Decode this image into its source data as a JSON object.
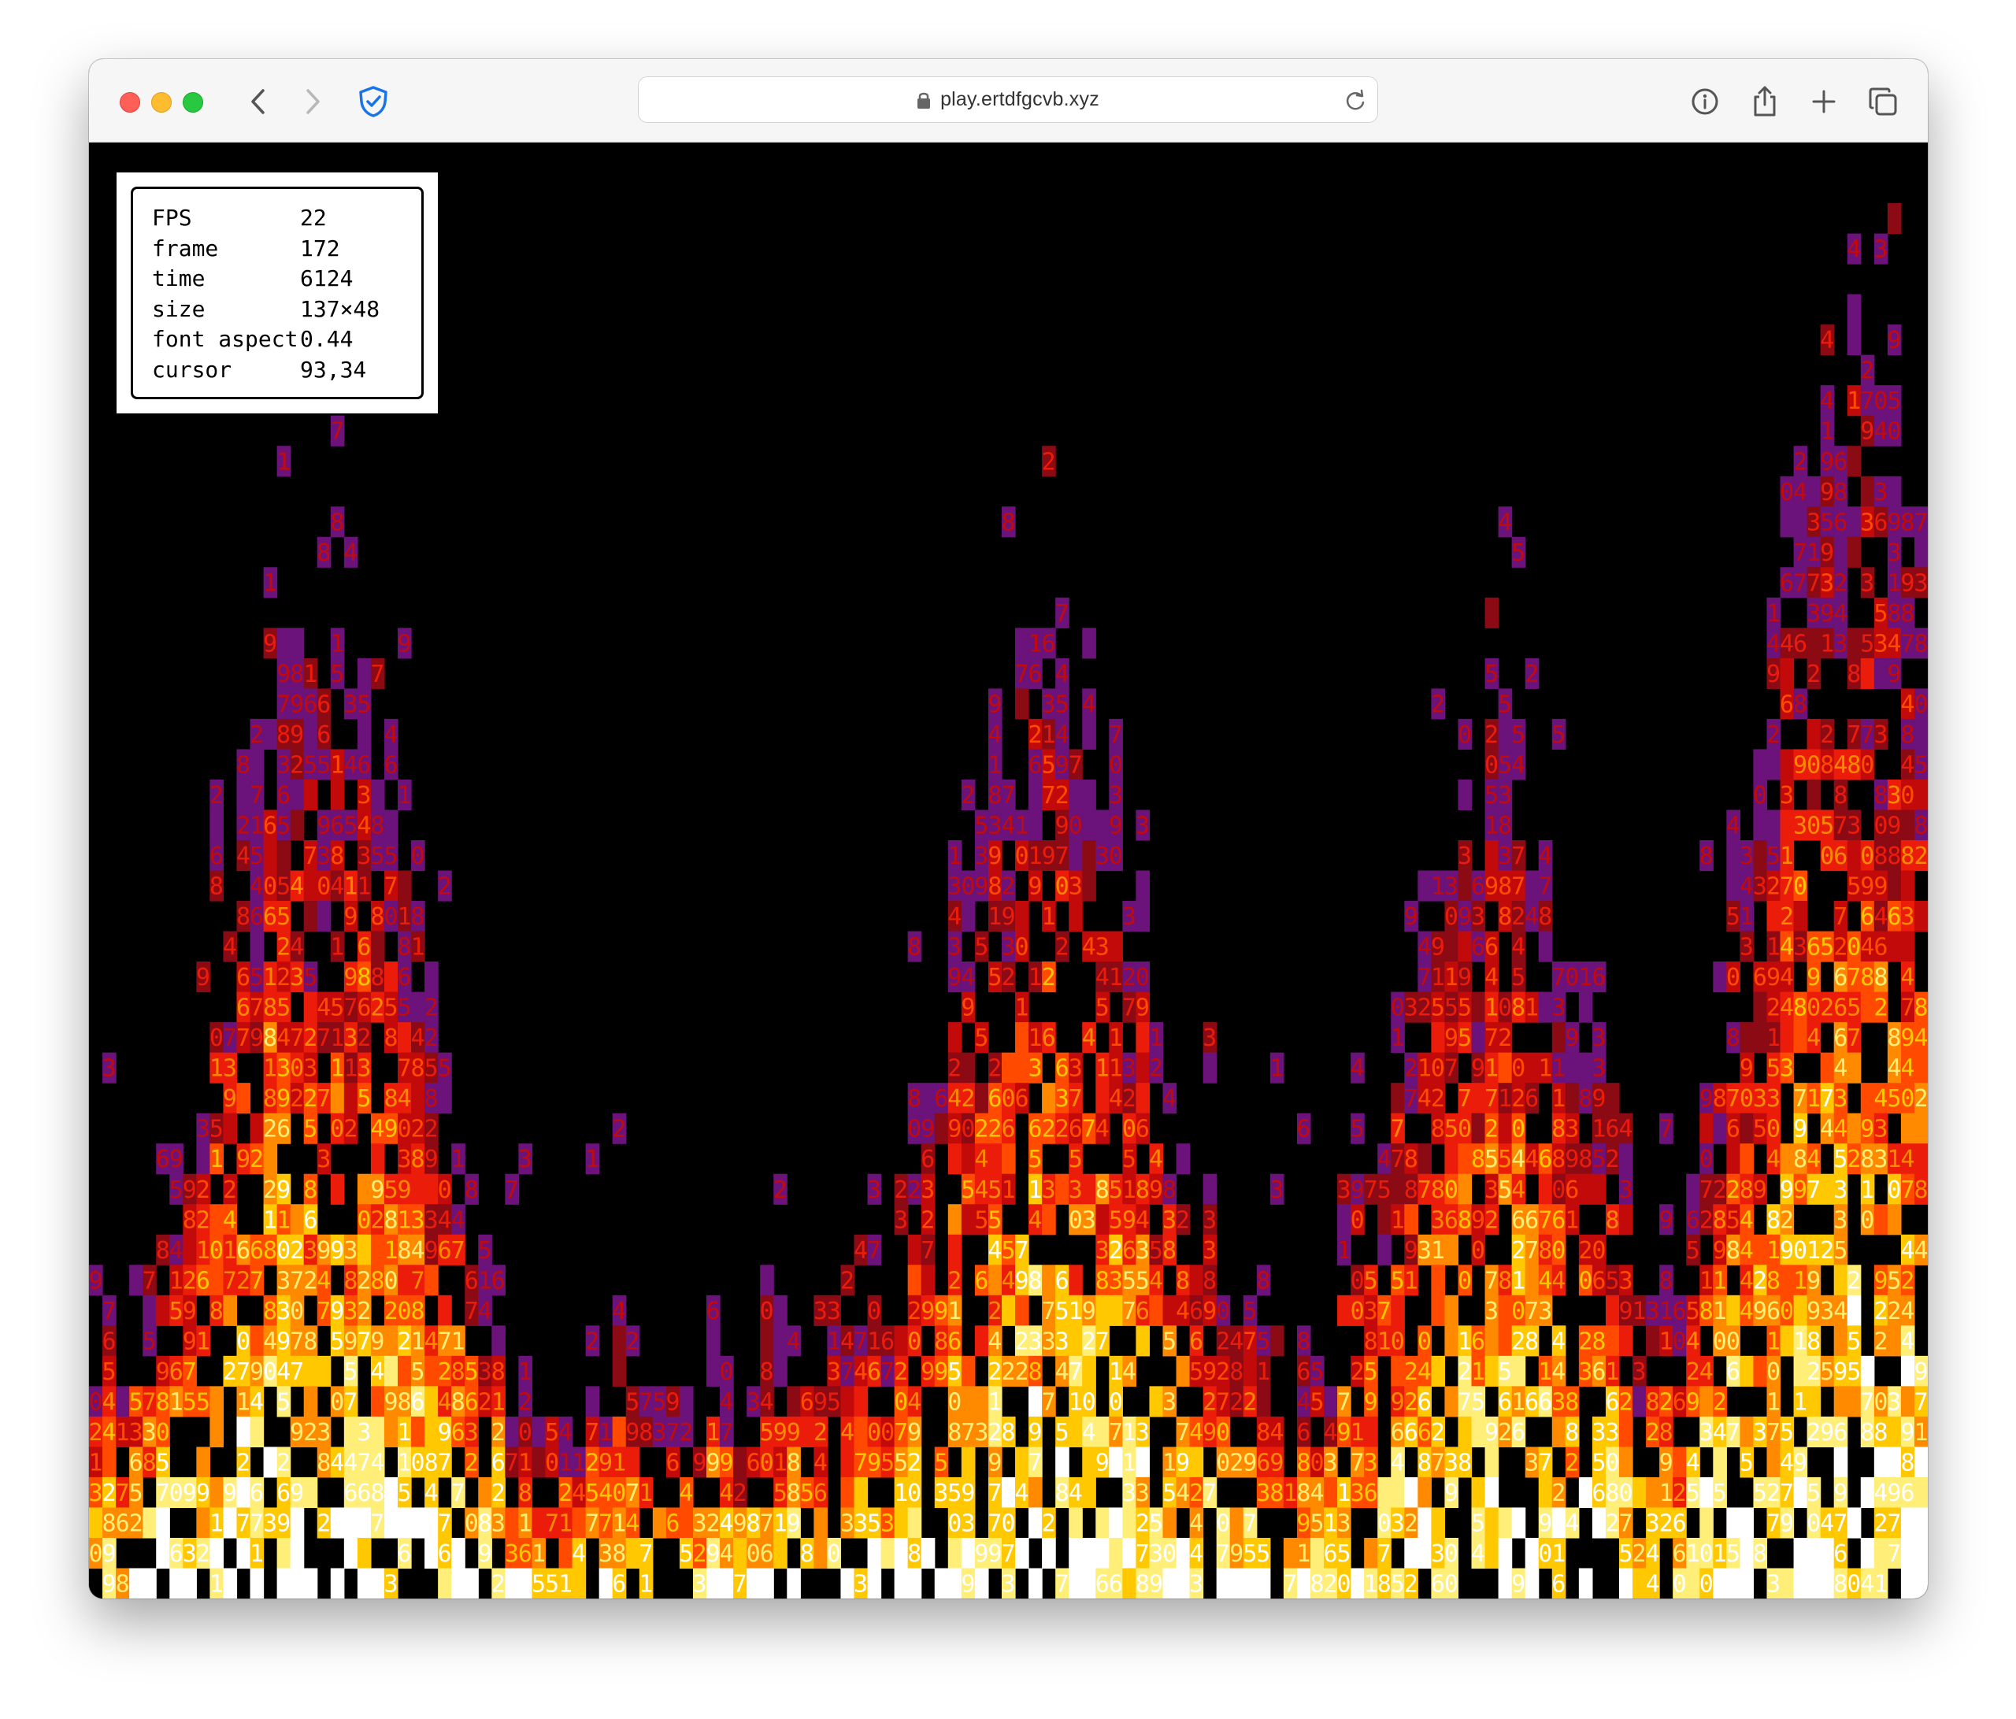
{
  "browser": {
    "url": "play.ertdfgcvb.xyz",
    "icons": {
      "back": "chevron-left-icon",
      "forward": "chevron-right-icon",
      "shield": "privacy-shield-icon",
      "lock": "lock-icon",
      "reload": "reload-icon",
      "info": "info-icon",
      "share": "share-icon",
      "new_tab": "plus-icon",
      "tabs": "tab-overview-icon"
    }
  },
  "stats": [
    {
      "key": "FPS",
      "value": "22"
    },
    {
      "key": "frame",
      "value": "172"
    },
    {
      "key": "time",
      "value": "6124"
    },
    {
      "key": "size",
      "value": "137×48"
    },
    {
      "key": "font aspect",
      "value": "0.44"
    },
    {
      "key": "cursor",
      "value": "93,34"
    }
  ],
  "fire": {
    "glyphs": "0123456789",
    "palette": [
      "#000000",
      "#6b137a",
      "#8c0a14",
      "#c20a0a",
      "#ec1c0a",
      "#ff4a00",
      "#ff8a00",
      "#ffc800",
      "#ffee77",
      "#ffffff"
    ]
  }
}
